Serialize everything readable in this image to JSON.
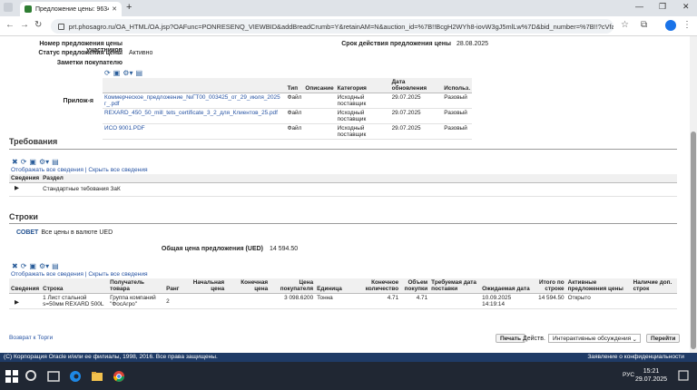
{
  "browser": {
    "tab_title": "Предложение цены: 963455 –",
    "url": "prt.phosagro.ru/OA_HTML/OA.jsp?OAFunc=PONRESENQ_VIEWBID&addBreadCrumb=Y&retainAM=N&auction_id=%7B!!BcgH2WYh8-iovW3gJ5mlLw%7D&bid_number=%7B!!?cVfak0tMXA8rn..."
  },
  "header": {
    "bid_owner_label": "Номер предложения цены участников",
    "valid_until_label": "Срок действия предложения цены",
    "valid_until_value": "28.08.2025",
    "status_label": "Статус предложения цены",
    "status_value": "Активно",
    "notes_label": "Заметки покупателю",
    "attachments_label": "Прилож-я"
  },
  "attachments": {
    "columns": [
      "Тип",
      "Описание",
      "Категория",
      "Дата обновления",
      "Использ."
    ],
    "rows": [
      {
        "file": "Коммерческое_предложение_№ГТ00_003425_от_29_июля_2025 г_.pdf",
        "type": "Файл",
        "desc": "",
        "category": "Исходный поставщик",
        "date": "29.07.2025",
        "usage": "Разовый"
      },
      {
        "file": "REXARD_450_50_mill_tets_certificate_3_2_для_Клиентов_25.pdf",
        "type": "Файл",
        "desc": "",
        "category": "Исходный поставщик",
        "date": "29.07.2025",
        "usage": "Разовый"
      },
      {
        "file": "ИСО 9001.PDF",
        "type": "Файл",
        "desc": "",
        "category": "Исходный поставщик",
        "date": "29.07.2025",
        "usage": "Разовый"
      }
    ]
  },
  "requirements": {
    "title": "Требования",
    "show_all": "Отображать все сведения",
    "hide_all": "Скрыть все сведения",
    "col_details": "Сведения",
    "col_section": "Раздел",
    "row_section": "Стандартные тебования ЗаК"
  },
  "lines": {
    "title": "Строки",
    "tip_badge": "СОВЕТ",
    "tip_text": "Все цены в валюте UED",
    "total_label": "Общая цена предложения (UED)",
    "total_value": "14 594.50",
    "show_all": "Отображать все сведения",
    "hide_all": "Скрыть все сведения",
    "columns": [
      "Сведения",
      "Строка",
      "Получатель товара",
      "Ранг",
      "Начальная цена",
      "Конечная цена",
      "Цена покупателя",
      "Единица",
      "Конечное количество",
      "Объем покупки",
      "Требуемая дата поставки",
      "Ожидаемая дата",
      "Итого по строке",
      "Активные предложения цены",
      "Наличие доп. строк"
    ],
    "row": {
      "line": "1 Лист стальной s=50мм REXARD 500L",
      "recipient": "Группа компаний \"ФосАгро\"",
      "rank": "2",
      "start_price": "",
      "final_price": "",
      "buyer_price": "3 098.6200",
      "unit": "Тонна",
      "final_qty": "4.71",
      "volume": "4.71",
      "req_date": "",
      "expected_date": "10.09.2025 14:19:14",
      "line_total": "14 594.50",
      "active_bids": "Открыто",
      "extra": ""
    }
  },
  "bottom": {
    "back_link": "Возврат к Торги",
    "print_button": "Печать",
    "actions_label": "Действ.",
    "actions_select": "Интерактивные обсуждения",
    "go_button": "Перейти"
  },
  "footer": {
    "copyright": "(C) Корпорация Oracle и/или ее филиалы, 1998, 2016. Все права защищены.",
    "privacy": "Заявление о конфиденциальности"
  },
  "taskbar": {
    "lang": "РУС",
    "time": "15:21",
    "date": "29.07.2025"
  }
}
